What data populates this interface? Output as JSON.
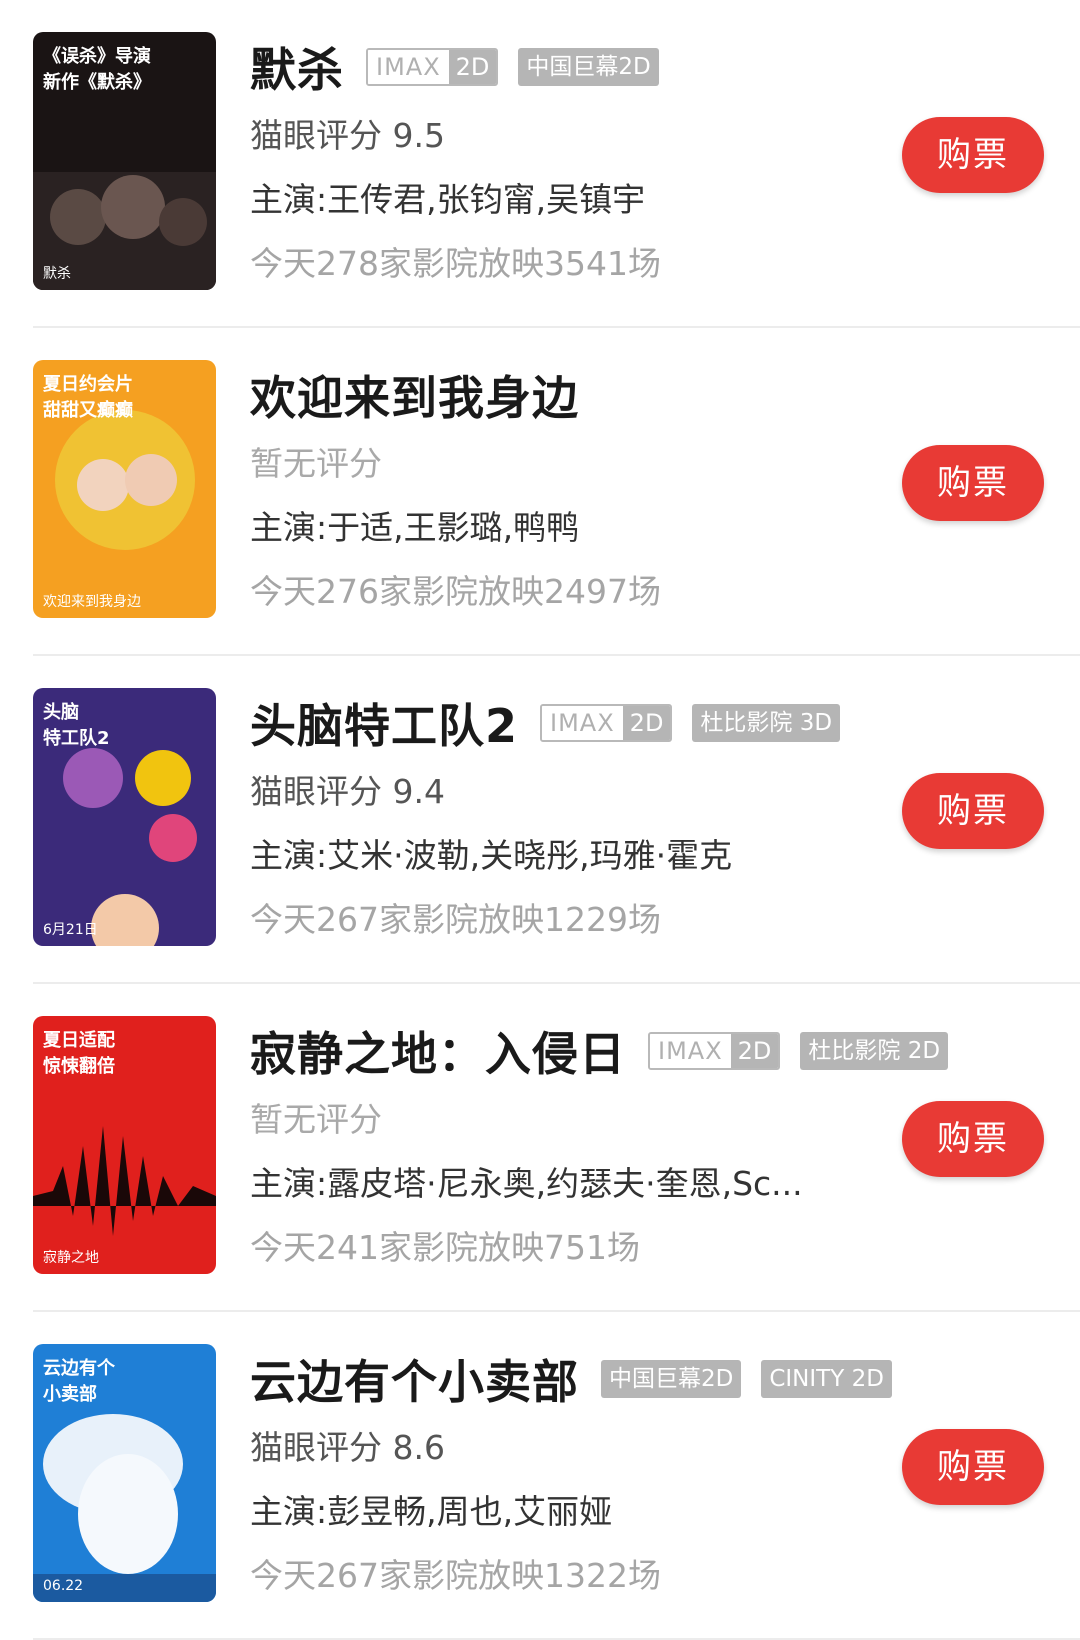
{
  "movies": [
    {
      "title": "默杀",
      "tags": [
        {
          "type": "imax",
          "a": "IMAX",
          "b": "2D"
        },
        {
          "type": "gray",
          "label": "中国巨幕2D"
        }
      ],
      "rating": "猫眼评分 9.5",
      "rated": true,
      "cast": "主演:王传君,张钧甯,吴镇宇",
      "shows": "今天278家影院放映3541场",
      "buy": "购票",
      "poster": {
        "bg": "#1a1414",
        "accent": "#c8182b",
        "text1": "《误杀》导演",
        "text2": "新作《默杀》",
        "mark": "默杀"
      }
    },
    {
      "title": "欢迎来到我身边",
      "tags": [],
      "rating": "暂无评分",
      "rated": false,
      "cast": "主演:于适,王影璐,鸭鸭",
      "shows": "今天276家影院放映2497场",
      "buy": "购票",
      "poster": {
        "bg": "#f5a021",
        "accent": "#f0c233",
        "text1": "夏日约会片",
        "text2": "甜甜又癫癫",
        "mark": "欢迎来到我身边"
      }
    },
    {
      "title": "头脑特工队2",
      "tags": [
        {
          "type": "imax",
          "a": "IMAX",
          "b": "2D"
        },
        {
          "type": "gray",
          "label": "杜比影院 3D"
        }
      ],
      "rating": "猫眼评分 9.4",
      "rated": true,
      "cast": "主演:艾米·波勒,关晓彤,玛雅·霍克",
      "shows": "今天267家影院放映1229场",
      "buy": "购票",
      "poster": {
        "bg": "#3b2a7a",
        "accent": "#e0457b",
        "text1": "头脑",
        "text2": "特工队2",
        "mark": "6月21日"
      }
    },
    {
      "title": "寂静之地：入侵日",
      "tags": [
        {
          "type": "imax",
          "a": "IMAX",
          "b": "2D"
        },
        {
          "type": "gray",
          "label": "杜比影院 2D"
        }
      ],
      "rating": "暂无评分",
      "rated": false,
      "cast": "主演:露皮塔·尼永奥,约瑟夫·奎恩,Sc...",
      "shows": "今天241家影院放映751场",
      "buy": "购票",
      "poster": {
        "bg": "#e0201d",
        "accent": "#1a0808",
        "text1": "夏日适配",
        "text2": "惊悚翻倍",
        "mark": "寂静之地"
      }
    },
    {
      "title": "云边有个小卖部",
      "tags": [
        {
          "type": "gray",
          "label": "中国巨幕2D"
        },
        {
          "type": "gray",
          "label": "CINITY 2D"
        }
      ],
      "rating": "猫眼评分 8.6",
      "rated": true,
      "cast": "主演:彭昱畅,周也,艾丽娅",
      "shows": "今天267家影院放映1322场",
      "buy": "购票",
      "poster": {
        "bg": "#1f7fd6",
        "accent": "#ffffff",
        "text1": "云边有个",
        "text2": "小卖部",
        "mark": "06.22"
      }
    }
  ],
  "colors": {
    "buy_bg": "#e83a35",
    "tag_bg": "#b5b5b5",
    "muted": "#a5a5a5"
  }
}
